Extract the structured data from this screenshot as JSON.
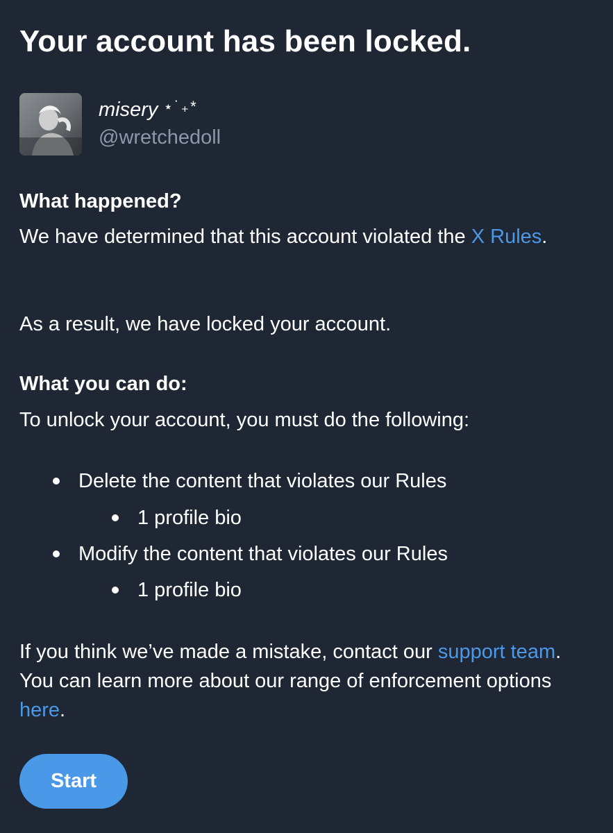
{
  "title": "Your account has been locked.",
  "user": {
    "display_name": "misery",
    "display_name_decoration": "⋆˙₊*",
    "handle": "@wretchedoll"
  },
  "what_happened": {
    "heading": "What happened?",
    "body_prefix": "We have determined that this account violated the ",
    "rules_link": "X Rules",
    "body_suffix": ".",
    "result": "As a result, we have locked your account."
  },
  "what_you_can_do": {
    "heading": "What you can do:",
    "intro": "To unlock your account, you must do the following:",
    "steps": [
      {
        "label": "Delete the content that violates our Rules",
        "sub": "1 profile bio"
      },
      {
        "label": "Modify the content that violates our Rules",
        "sub": "1 profile bio"
      }
    ]
  },
  "footer": {
    "prefix": "If you think we’ve made a mistake, contact our ",
    "support_link": "support team",
    "middle": ". You can learn more about our range of enforcement options ",
    "here_link": "here",
    "suffix": "."
  },
  "start_button": "Start",
  "colors": {
    "background": "#1f2734",
    "text": "#ffffff",
    "secondary_text": "#8b98a5",
    "link": "#4a99e9",
    "button": "#4a99e9"
  },
  "icons": [
    "avatar-photo",
    "bullet-dot"
  ]
}
